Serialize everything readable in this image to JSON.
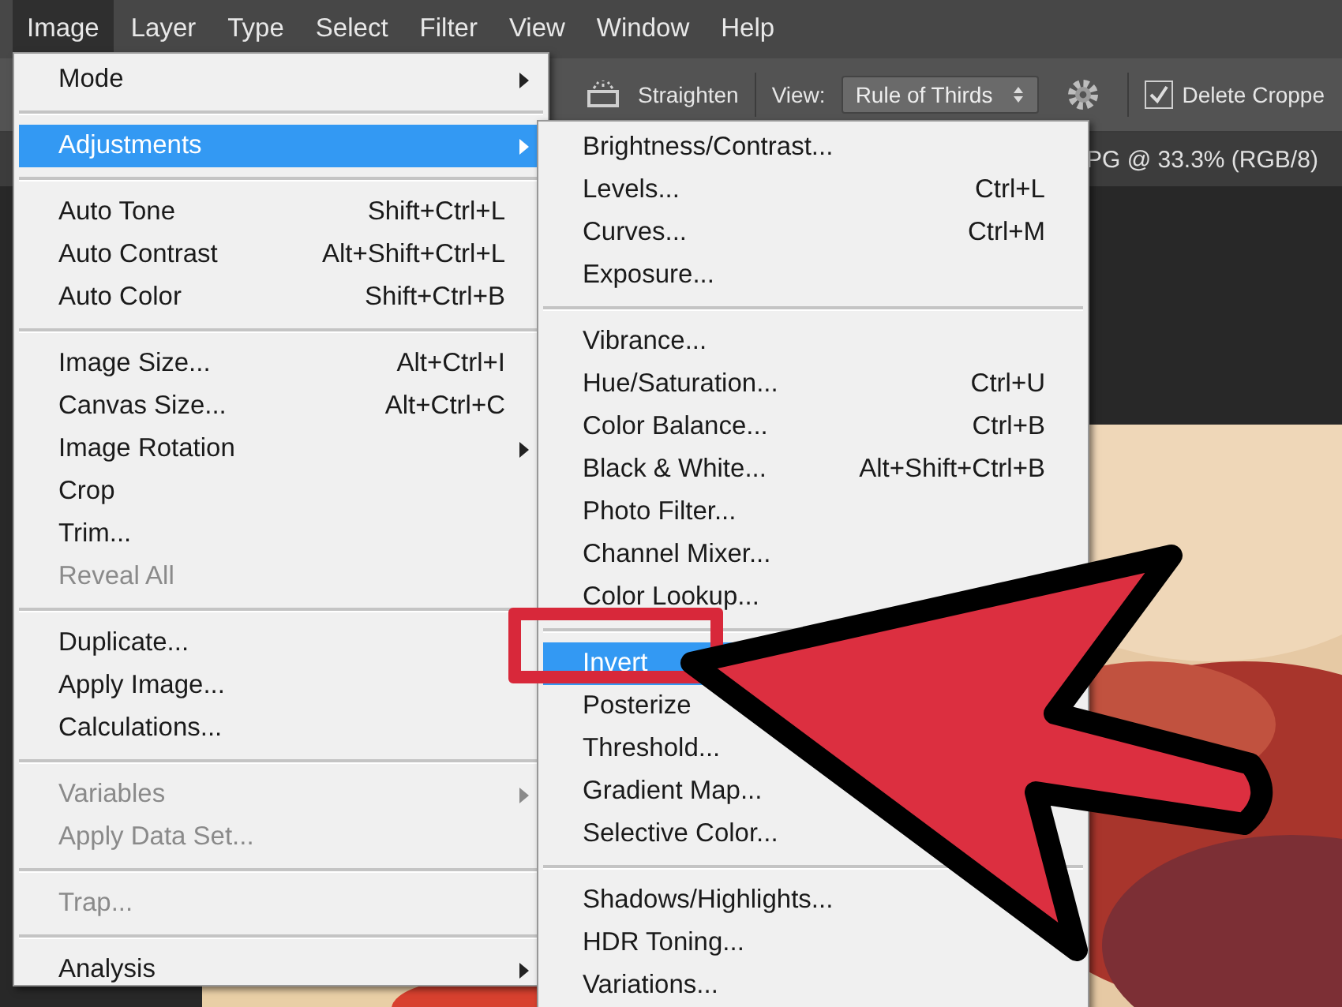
{
  "menu_bar": [
    {
      "label": "Image",
      "selected": true
    },
    {
      "label": "Layer",
      "selected": false
    },
    {
      "label": "Type",
      "selected": false
    },
    {
      "label": "Select",
      "selected": false
    },
    {
      "label": "Filter",
      "selected": false
    },
    {
      "label": "View",
      "selected": false
    },
    {
      "label": "Window",
      "selected": false
    },
    {
      "label": "Help",
      "selected": false
    }
  ],
  "options_bar": {
    "straighten_label": "Straighten",
    "view_label": "View:",
    "view_select": "Rule of Thirds",
    "delete_cropped": {
      "label": "Delete Croppe",
      "checked": true
    }
  },
  "document_tab": {
    "title": "PG @ 33.3% (RGB/8)"
  },
  "image_menu": [
    {
      "kind": "item",
      "label": "Mode",
      "submenu": true,
      "disabled": false,
      "selected": false
    },
    {
      "kind": "separator"
    },
    {
      "kind": "item",
      "label": "Adjustments",
      "submenu": true,
      "disabled": false,
      "selected": true
    },
    {
      "kind": "separator"
    },
    {
      "kind": "item",
      "label": "Auto Tone",
      "shortcut": "Shift+Ctrl+L",
      "disabled": false,
      "selected": false
    },
    {
      "kind": "item",
      "label": "Auto Contrast",
      "shortcut": "Alt+Shift+Ctrl+L",
      "disabled": false,
      "selected": false
    },
    {
      "kind": "item",
      "label": "Auto Color",
      "shortcut": "Shift+Ctrl+B",
      "disabled": false,
      "selected": false
    },
    {
      "kind": "separator"
    },
    {
      "kind": "item",
      "label": "Image Size...",
      "shortcut": "Alt+Ctrl+I",
      "disabled": false,
      "selected": false
    },
    {
      "kind": "item",
      "label": "Canvas Size...",
      "shortcut": "Alt+Ctrl+C",
      "disabled": false,
      "selected": false
    },
    {
      "kind": "item",
      "label": "Image Rotation",
      "submenu": true,
      "disabled": false,
      "selected": false
    },
    {
      "kind": "item",
      "label": "Crop",
      "disabled": false,
      "selected": false
    },
    {
      "kind": "item",
      "label": "Trim...",
      "disabled": false,
      "selected": false
    },
    {
      "kind": "item",
      "label": "Reveal All",
      "disabled": true,
      "selected": false
    },
    {
      "kind": "separator"
    },
    {
      "kind": "item",
      "label": "Duplicate...",
      "disabled": false,
      "selected": false
    },
    {
      "kind": "item",
      "label": "Apply Image...",
      "disabled": false,
      "selected": false
    },
    {
      "kind": "item",
      "label": "Calculations...",
      "disabled": false,
      "selected": false
    },
    {
      "kind": "separator"
    },
    {
      "kind": "item",
      "label": "Variables",
      "submenu": true,
      "disabled": true,
      "selected": false
    },
    {
      "kind": "item",
      "label": "Apply Data Set...",
      "disabled": true,
      "selected": false
    },
    {
      "kind": "separator"
    },
    {
      "kind": "item",
      "label": "Trap...",
      "disabled": true,
      "selected": false
    },
    {
      "kind": "separator"
    },
    {
      "kind": "item",
      "label": "Analysis",
      "submenu": true,
      "disabled": false,
      "selected": false
    }
  ],
  "adjustments_menu": [
    {
      "kind": "item",
      "label": "Brightness/Contrast...",
      "selected": false
    },
    {
      "kind": "item",
      "label": "Levels...",
      "shortcut": "Ctrl+L",
      "selected": false
    },
    {
      "kind": "item",
      "label": "Curves...",
      "shortcut": "Ctrl+M",
      "selected": false
    },
    {
      "kind": "item",
      "label": "Exposure...",
      "selected": false
    },
    {
      "kind": "separator"
    },
    {
      "kind": "item",
      "label": "Vibrance...",
      "selected": false
    },
    {
      "kind": "item",
      "label": "Hue/Saturation...",
      "shortcut": "Ctrl+U",
      "selected": false
    },
    {
      "kind": "item",
      "label": "Color Balance...",
      "shortcut": "Ctrl+B",
      "selected": false
    },
    {
      "kind": "item",
      "label": "Black & White...",
      "shortcut": "Alt+Shift+Ctrl+B",
      "selected": false
    },
    {
      "kind": "item",
      "label": "Photo Filter...",
      "selected": false
    },
    {
      "kind": "item",
      "label": "Channel Mixer...",
      "selected": false
    },
    {
      "kind": "item",
      "label": "Color Lookup...",
      "selected": false
    },
    {
      "kind": "separator"
    },
    {
      "kind": "item",
      "label": "Invert",
      "selected": true
    },
    {
      "kind": "item",
      "label": "Posterize",
      "selected": false
    },
    {
      "kind": "item",
      "label": "Threshold...",
      "selected": false
    },
    {
      "kind": "item",
      "label": "Gradient Map...",
      "selected": false
    },
    {
      "kind": "item",
      "label": "Selective Color...",
      "selected": false
    },
    {
      "kind": "separator"
    },
    {
      "kind": "item",
      "label": "Shadows/Highlights...",
      "selected": false
    },
    {
      "kind": "item",
      "label": "HDR Toning...",
      "selected": false
    },
    {
      "kind": "item",
      "label": "Variations...",
      "selected": false
    }
  ]
}
